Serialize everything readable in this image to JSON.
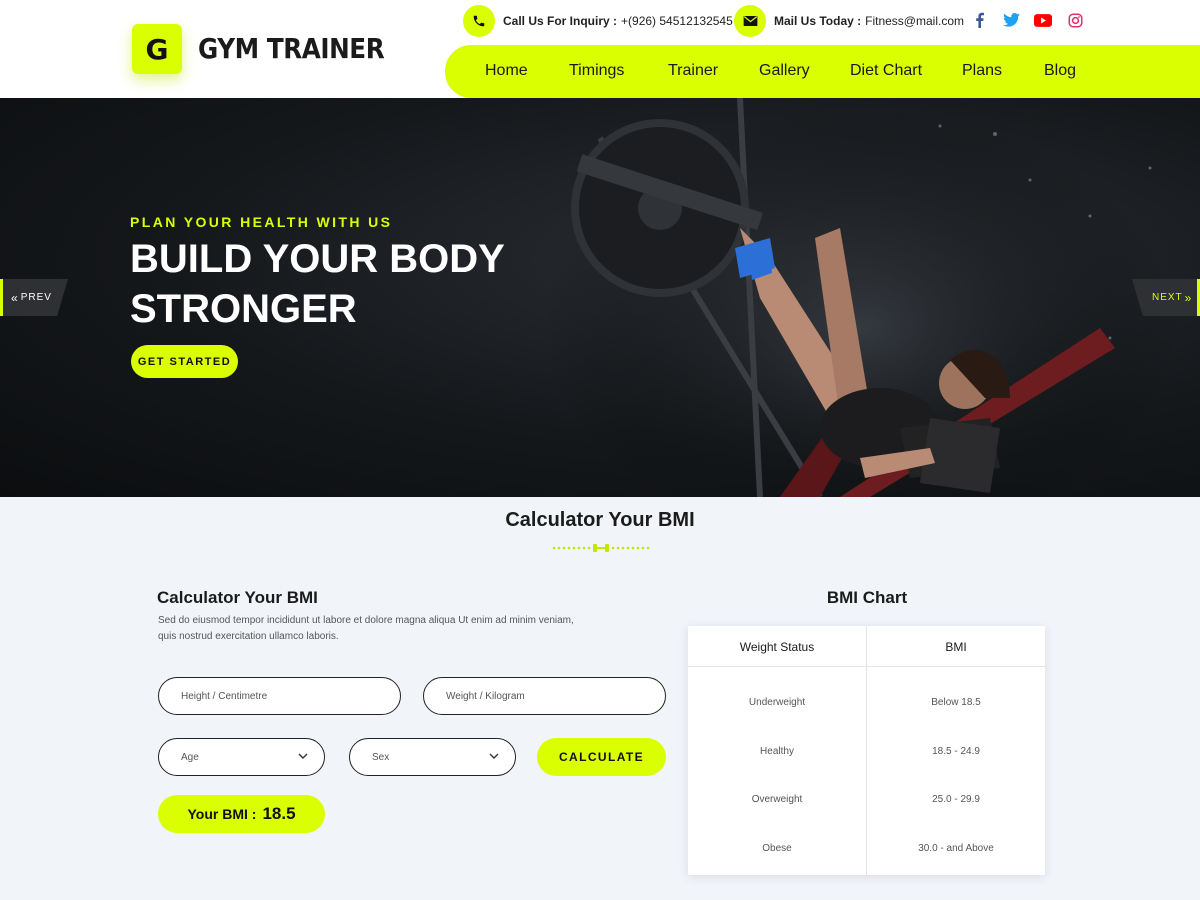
{
  "brand": {
    "logo_letter": "G",
    "name": "GYM TRAINER"
  },
  "contact": {
    "phone_label": "Call Us For Inquiry :",
    "phone_value": "+(926) 54512132545",
    "mail_label": "Mail Us Today :",
    "mail_value": "Fitness@mail.com"
  },
  "social": [
    "facebook-icon",
    "twitter-icon",
    "youtube-icon",
    "instagram-icon"
  ],
  "nav": {
    "items": [
      "Home",
      "Timings",
      "Trainer",
      "Gallery",
      "Diet Chart",
      "Plans",
      "Blog"
    ]
  },
  "hero": {
    "eyebrow": "PLAN YOUR HEALTH WITH US",
    "headline": "BUILD YOUR BODY STRONGER",
    "cta": "GET STARTED",
    "prev": "PREV",
    "next": "NEXT"
  },
  "bmi": {
    "section_title": "Calculator Your BMI",
    "form_title": "Calculator Your BMI",
    "description": "Sed do eiusmod tempor incididunt ut labore et dolore magna aliqua Ut enim ad minim veniam, quis nostrud exercitation ullamco laboris.",
    "height_placeholder": "Height / Centimetre",
    "weight_placeholder": "Weight / Kilogram",
    "age_value": "Age",
    "sex_value": "Sex",
    "calculate": "CALCULATE",
    "result_label": "Your BMI :",
    "result_value": "18.5"
  },
  "chart": {
    "title": "BMI Chart",
    "headers": [
      "Weight Status",
      "BMI"
    ],
    "rows": [
      [
        "Underweight",
        "Below 18.5"
      ],
      [
        "Healthy",
        "18.5 - 24.9"
      ],
      [
        "Overweight",
        "25.0 - 29.9"
      ],
      [
        "Obese",
        "30.0 - and Above"
      ]
    ]
  },
  "colors": {
    "accent": "#d9ff00",
    "dark": "#111111",
    "background": "#f1f5fa"
  }
}
